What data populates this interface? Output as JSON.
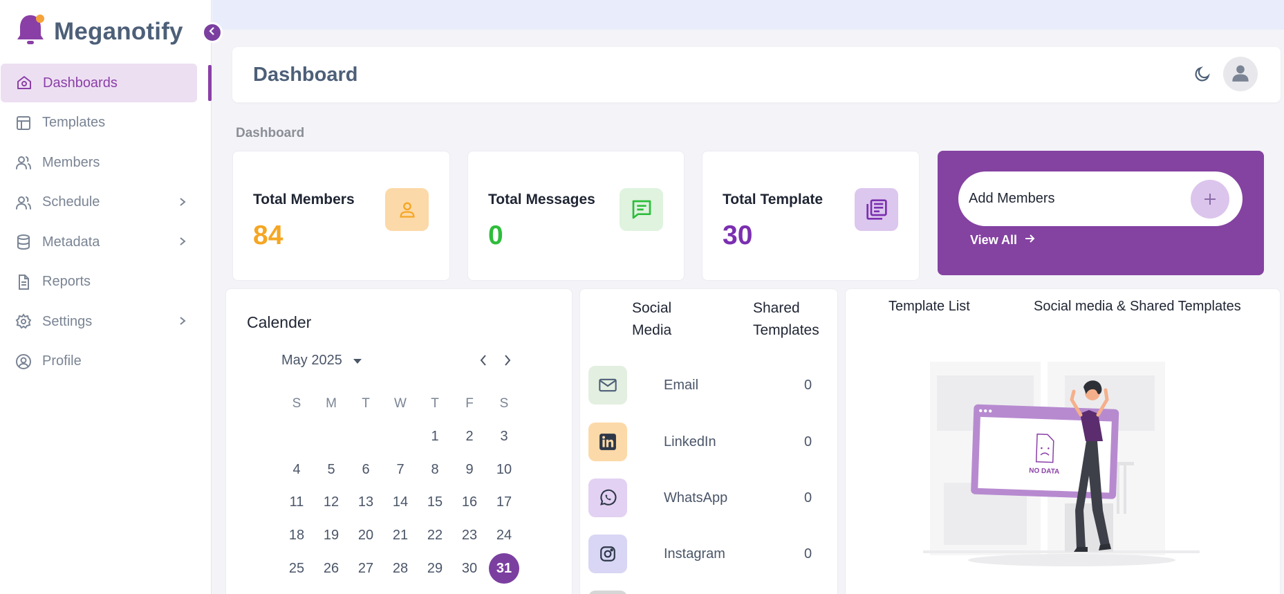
{
  "app": {
    "name": "Meganotify"
  },
  "sidebar": {
    "items": [
      {
        "label": "Dashboards",
        "icon": "home-icon",
        "active": true
      },
      {
        "label": "Templates",
        "icon": "layout-icon"
      },
      {
        "label": "Members",
        "icon": "users-icon"
      },
      {
        "label": "Schedule",
        "icon": "users-icon",
        "has_children": true
      },
      {
        "label": "Metadata",
        "icon": "database-icon",
        "has_children": true
      },
      {
        "label": "Reports",
        "icon": "file-text-icon"
      },
      {
        "label": "Settings",
        "icon": "gear-icon",
        "has_children": true
      },
      {
        "label": "Profile",
        "icon": "user-circle-icon"
      }
    ]
  },
  "header": {
    "title": "Dashboard"
  },
  "breadcrumb": "Dashboard",
  "stats": [
    {
      "title": "Total Members",
      "value": "84",
      "color": "#f5a623",
      "icon_bg": "#fcd9a8",
      "icon": "user-icon"
    },
    {
      "title": "Total Messages",
      "value": "0",
      "color": "#2ebd3b",
      "icon_bg": "#dff3df",
      "icon": "message-icon"
    },
    {
      "title": "Total Template",
      "value": "30",
      "color": "#7b2fb0",
      "icon_bg": "#dcc7ee",
      "icon": "newspaper-icon"
    }
  ],
  "add_members": {
    "label": "Add Members",
    "view_all": "View All"
  },
  "calendar": {
    "title": "Calender",
    "month": "May 2025",
    "weekdays": [
      "S",
      "M",
      "T",
      "W",
      "T",
      "F",
      "S"
    ],
    "days": [
      "",
      "",
      "",
      "",
      "1",
      "2",
      "3",
      "4",
      "5",
      "6",
      "7",
      "8",
      "9",
      "10",
      "11",
      "12",
      "13",
      "14",
      "15",
      "16",
      "17",
      "18",
      "19",
      "20",
      "21",
      "22",
      "23",
      "24",
      "25",
      "26",
      "27",
      "28",
      "29",
      "30",
      "31"
    ],
    "selected": "31"
  },
  "social": {
    "col1_line1": "Social",
    "col1_line2": "Media",
    "col2_line1": "Shared",
    "col2_line2": "Templates",
    "rows": [
      {
        "name": "Email",
        "count": "0",
        "icon": "mail-icon",
        "bg": "#e3efe0"
      },
      {
        "name": "LinkedIn",
        "count": "0",
        "icon": "linkedin-icon",
        "bg": "#fcd9a8"
      },
      {
        "name": "WhatsApp",
        "count": "0",
        "icon": "whatsapp-icon",
        "bg": "#e2d1f2"
      },
      {
        "name": "Instagram",
        "count": "0",
        "icon": "instagram-icon",
        "bg": "#d8d6f4"
      }
    ]
  },
  "templates": {
    "head1": "Template List",
    "head2": "Social media & Shared Templates",
    "empty_label": "NO DATA"
  }
}
